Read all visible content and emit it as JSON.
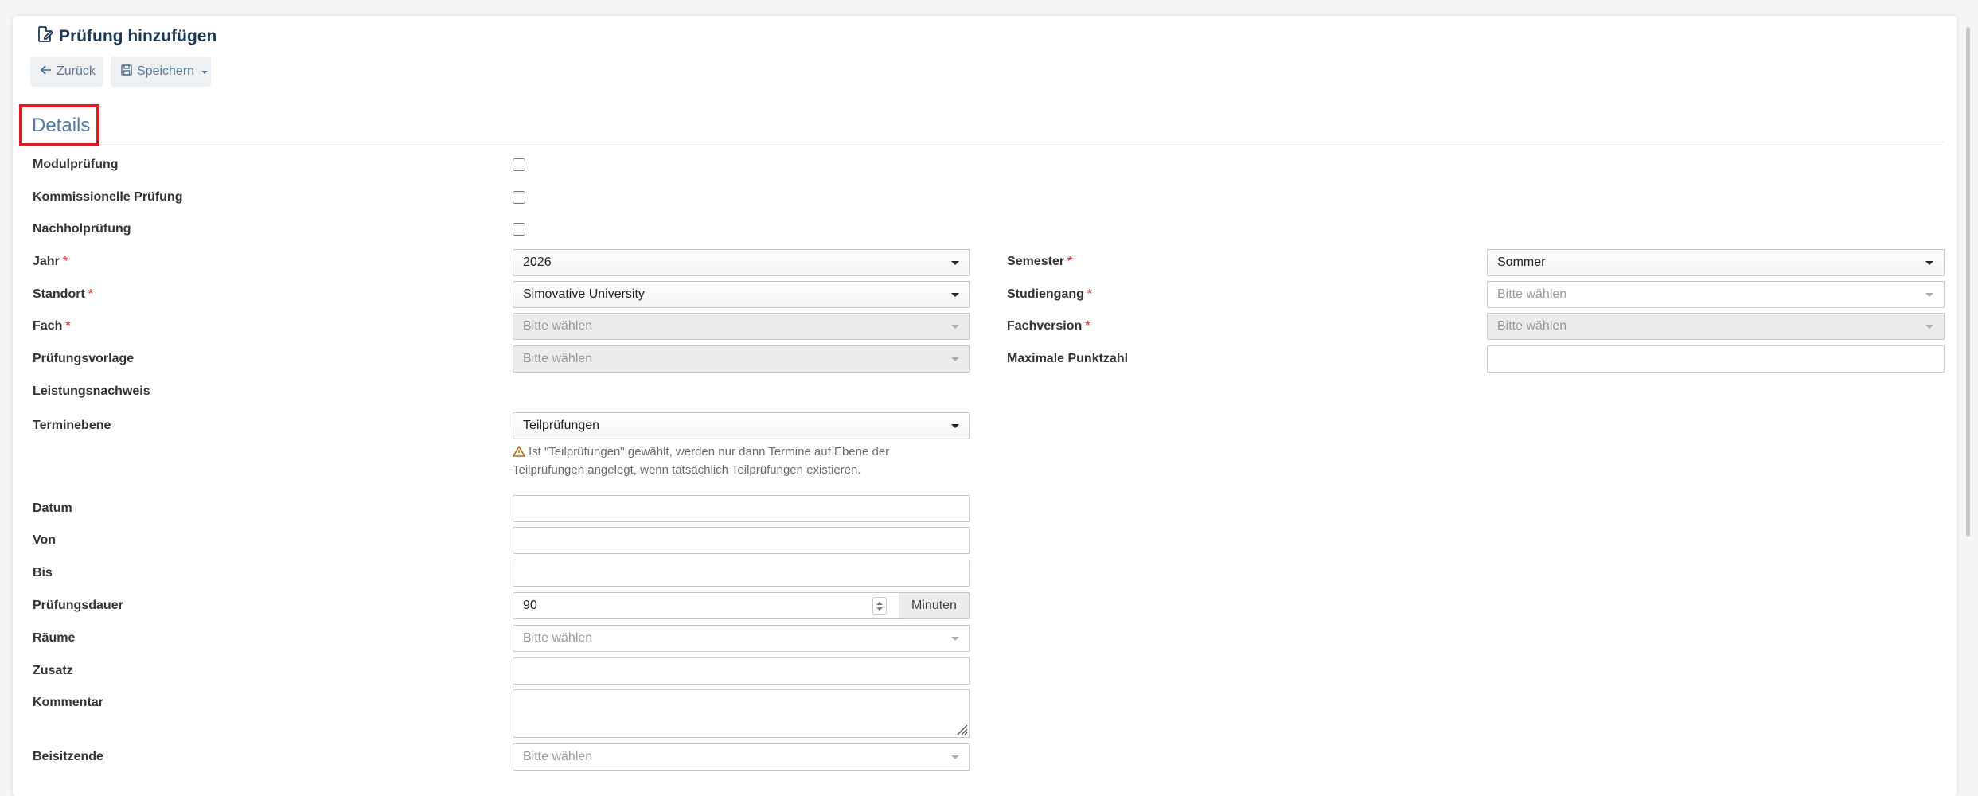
{
  "header": {
    "title": "Prüfung hinzufügen",
    "back_label": "Zurück",
    "save_label": "Speichern"
  },
  "section": {
    "title": "Details"
  },
  "fields": {
    "modulpruefung": {
      "label": "Modulprüfung",
      "checked": false
    },
    "kommissionelle": {
      "label": "Kommissionelle Prüfung",
      "checked": false
    },
    "nachholpruefung": {
      "label": "Nachholprüfung",
      "checked": false
    },
    "jahr": {
      "label": "Jahr",
      "required": "*",
      "value": "2026"
    },
    "semester": {
      "label": "Semester",
      "required": "*",
      "value": "Sommer"
    },
    "standort": {
      "label": "Standort",
      "required": "*",
      "value": "Simovative University"
    },
    "studiengang": {
      "label": "Studiengang",
      "required": "*",
      "placeholder": "Bitte wählen"
    },
    "fach": {
      "label": "Fach",
      "required": "*",
      "placeholder": "Bitte wählen"
    },
    "fachversion": {
      "label": "Fachversion",
      "required": "*",
      "placeholder": "Bitte wählen"
    },
    "pruefungsvorlage": {
      "label": "Prüfungsvorlage",
      "placeholder": "Bitte wählen"
    },
    "maximale_punktzahl": {
      "label": "Maximale Punktzahl",
      "value": ""
    },
    "leistungsnachweis": {
      "label": "Leistungsnachweis"
    },
    "terminebene": {
      "label": "Terminebene",
      "value": "Teilprüfungen",
      "note_line1": "Ist \"Teilprüfungen\" gewählt, werden nur dann Termine auf Ebene der",
      "note_line2": "Teilprüfungen angelegt, wenn tatsächlich Teilprüfungen existieren."
    },
    "datum": {
      "label": "Datum",
      "value": ""
    },
    "von": {
      "label": "Von",
      "value": ""
    },
    "bis": {
      "label": "Bis",
      "value": ""
    },
    "pruefungsdauer": {
      "label": "Prüfungsdauer",
      "value": "90",
      "unit": "Minuten"
    },
    "raeume": {
      "label": "Räume",
      "placeholder": "Bitte wählen"
    },
    "zusatz": {
      "label": "Zusatz",
      "value": ""
    },
    "kommentar": {
      "label": "Kommentar",
      "value": ""
    },
    "beisitzende": {
      "label": "Beisitzende",
      "placeholder": "Bitte wählen"
    }
  },
  "icons": {
    "title": "edit-document-icon",
    "back": "arrow-left-icon",
    "save": "floppy-disk-icon",
    "note": "warning-triangle-icon"
  },
  "colors": {
    "accent": "#4f7da6",
    "title": "#1b3a57",
    "required": "#d9534f",
    "highlight": "#e01b24"
  }
}
